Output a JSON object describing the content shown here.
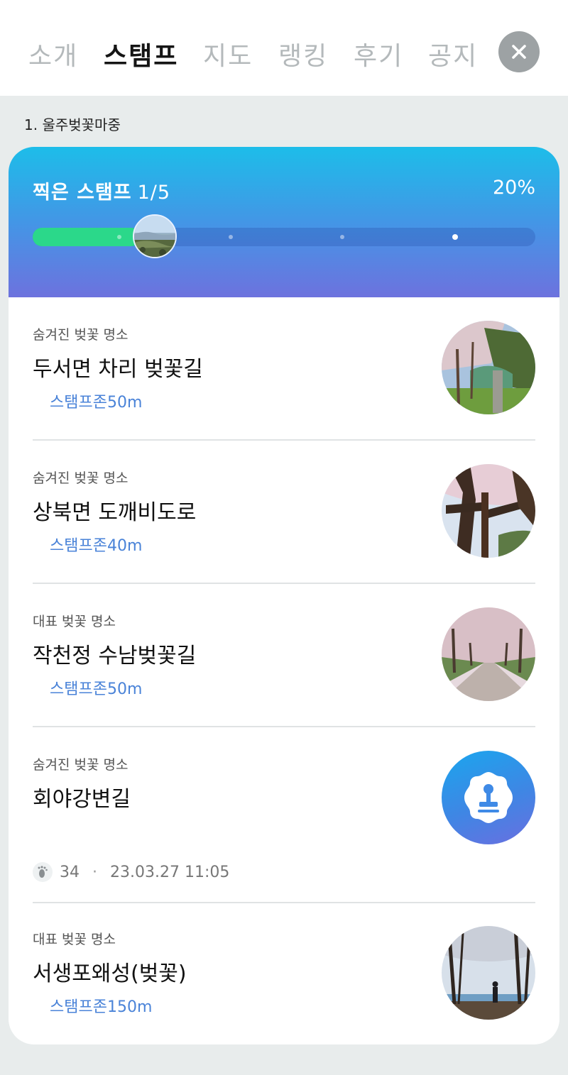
{
  "tabs": [
    {
      "label": "소개",
      "active": false
    },
    {
      "label": "스탬프",
      "active": true
    },
    {
      "label": "지도",
      "active": false
    },
    {
      "label": "랭킹",
      "active": false
    },
    {
      "label": "후기",
      "active": false
    },
    {
      "label": "공지",
      "active": false
    }
  ],
  "close_icon": "close-icon",
  "course_label": "1. 울주벚꽃마중",
  "progress": {
    "title": "찍은 스탬프",
    "count": "1/5",
    "percent_text": "20%",
    "stamped": 1,
    "total": 5,
    "fill_color": "#2bd88a"
  },
  "places": [
    {
      "category": "숨겨진 벚꽃 명소",
      "name": "두서면 차리 벚꽃길",
      "zone": "스탬프존50m",
      "stamped": false
    },
    {
      "category": "숨겨진 벚꽃 명소",
      "name": "상북면 도깨비도로",
      "zone": "스탬프존40m",
      "stamped": false
    },
    {
      "category": "대표 벚꽃 명소",
      "name": "작천정 수남벚꽃길",
      "zone": "스탬프존50m",
      "stamped": false
    },
    {
      "category": "숨겨진 벚꽃 명소",
      "name": "회야강변길",
      "stamped": true,
      "steps": "34",
      "stamp_time": "23.03.27 11:05",
      "badge_icon": "stamp-icon",
      "steps_icon": "footprint-icon"
    },
    {
      "category": "대표 벚꽃 명소",
      "name": "서생포왜성(벚꽃)",
      "zone": "스탬프존150m",
      "stamped": false
    }
  ],
  "colors": {
    "accent_blue": "#4a83d8",
    "header_gradient_top": "#1dbde9",
    "header_gradient_bottom": "#6d72de"
  }
}
